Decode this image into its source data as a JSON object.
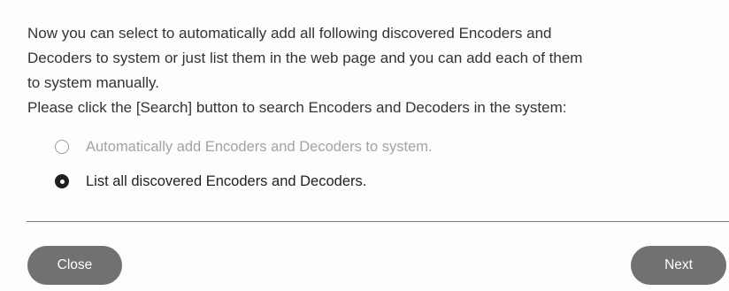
{
  "dialog": {
    "paragraph_lines": [
      "Now you can select to automatically add all following discovered Encoders and",
      "Decoders to system or just list them in the web page and you can add each of them",
      "to system manually.",
      "Please click the [Search] button to search Encoders and Decoders in the system:"
    ],
    "options": [
      {
        "label": "Automatically add Encoders and Decoders to system.",
        "selected": false
      },
      {
        "label": "List all discovered Encoders and Decoders.",
        "selected": true
      }
    ],
    "buttons": {
      "close_label": "Close",
      "next_label": "Next"
    }
  },
  "colors": {
    "button_bg": "#6f7173",
    "text": "#333333",
    "disabled_text": "#a3a3a3"
  }
}
